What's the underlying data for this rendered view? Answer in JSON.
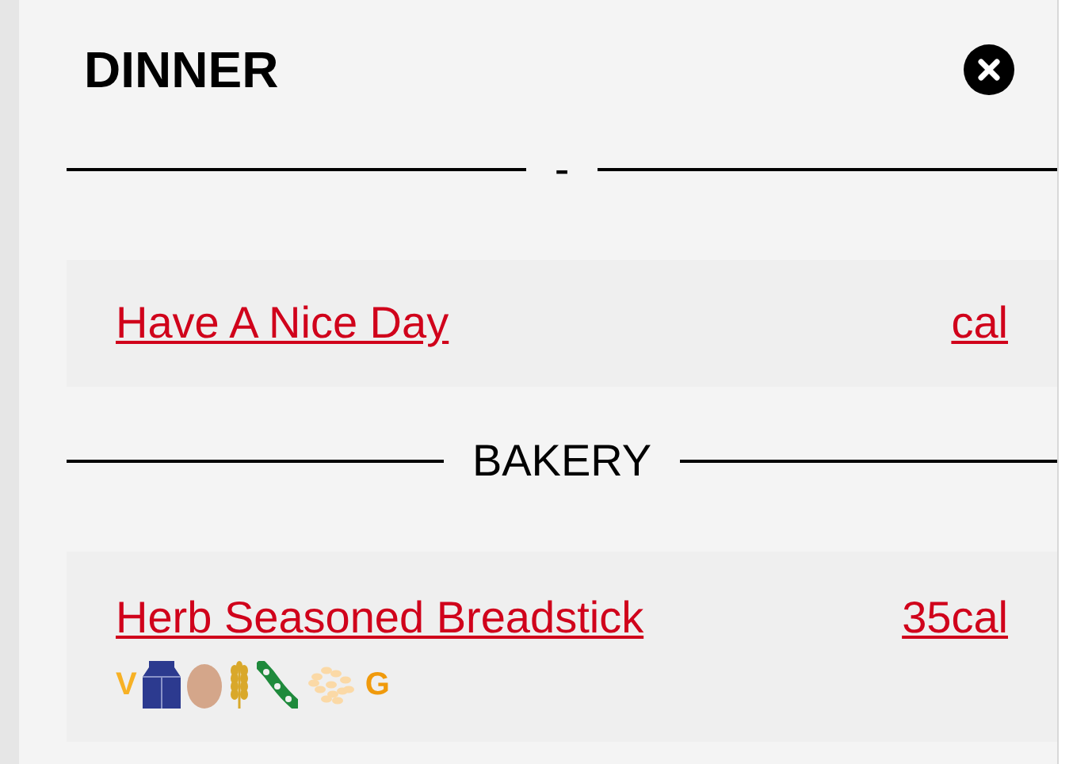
{
  "title": "DINNER",
  "sections": [
    {
      "heading": "-",
      "items": [
        {
          "name": "Have A Nice Day",
          "calories": "cal"
        }
      ]
    },
    {
      "heading": "BAKERY",
      "items": [
        {
          "name": "Herb Seasoned Breadstick",
          "calories": "35cal",
          "icons": [
            {
              "kind": "letter",
              "text": "V",
              "color": "#f7b125"
            },
            {
              "kind": "milk"
            },
            {
              "kind": "egg"
            },
            {
              "kind": "wheat"
            },
            {
              "kind": "soy"
            },
            {
              "kind": "sesame"
            },
            {
              "kind": "letter",
              "text": "G",
              "color": "#f09a0c"
            }
          ]
        }
      ]
    }
  ]
}
